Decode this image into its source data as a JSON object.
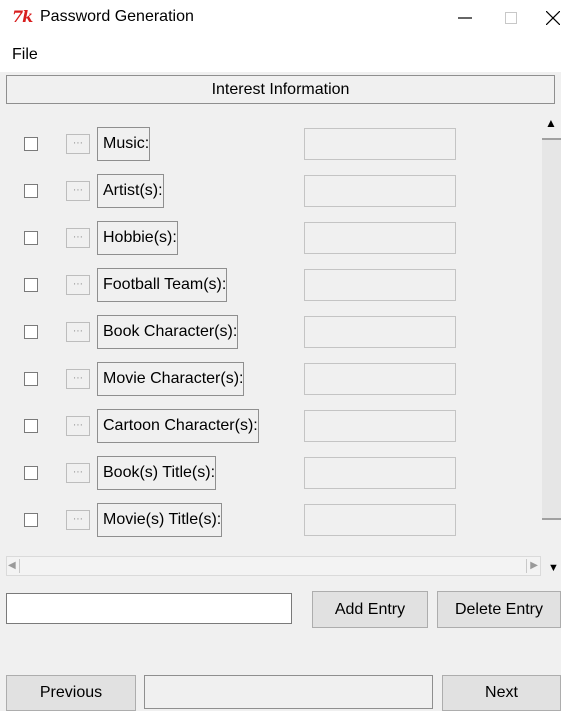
{
  "window": {
    "logo_text": "7k",
    "title": "Password Generation",
    "minimize_glyph": "—",
    "maximize_glyph": "☐",
    "close_glyph": "✕"
  },
  "menu": {
    "file": "File"
  },
  "section": {
    "header": "Interest Information"
  },
  "rows": [
    {
      "label": "Music:",
      "checked": false,
      "entry": ""
    },
    {
      "label": "Artist(s):",
      "checked": false,
      "entry": ""
    },
    {
      "label": "Hobbie(s):",
      "checked": false,
      "entry": ""
    },
    {
      "label": "Football Team(s):",
      "checked": false,
      "entry": ""
    },
    {
      "label": "Book Character(s):",
      "checked": false,
      "entry": ""
    },
    {
      "label": "Movie Character(s):",
      "checked": false,
      "entry": ""
    },
    {
      "label": "Cartoon Character(s):",
      "checked": false,
      "entry": ""
    },
    {
      "label": "Book(s) Title(s):",
      "checked": false,
      "entry": ""
    },
    {
      "label": "Movie(s) Title(s):",
      "checked": false,
      "entry": ""
    }
  ],
  "scroll": {
    "up": "▲",
    "down": "▼",
    "left": "◀",
    "right": "▶"
  },
  "entry_controls": {
    "new_entry_value": "",
    "add_label": "Add Entry",
    "delete_label": "Delete Entry"
  },
  "nav": {
    "previous_label": "Previous",
    "next_label": "Next",
    "status_text": ""
  },
  "icons": {
    "logo": "tk-feather-logo-icon",
    "minimize": "minimize-icon",
    "maximize": "maximize-icon",
    "close": "close-icon"
  },
  "colors": {
    "logo": "#d81e1e",
    "background": "#f0f0f0"
  }
}
